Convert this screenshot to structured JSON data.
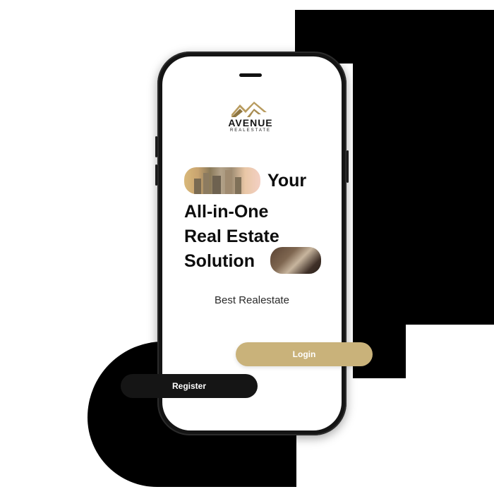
{
  "brand": {
    "name": "AVENUE",
    "sub": "REALESTATE",
    "logo_icon": "house-roof-logo-icon",
    "gold": "#c9b27a",
    "dark": "#151515"
  },
  "hero": {
    "line1": "Your",
    "line2": "All-in-One",
    "line3": "Real Estate",
    "line4": "Solution",
    "image1": "city-skyline-image",
    "image2": "living-room-image"
  },
  "tagline": "Best Realestate",
  "buttons": {
    "login": "Login",
    "register": "Register"
  }
}
